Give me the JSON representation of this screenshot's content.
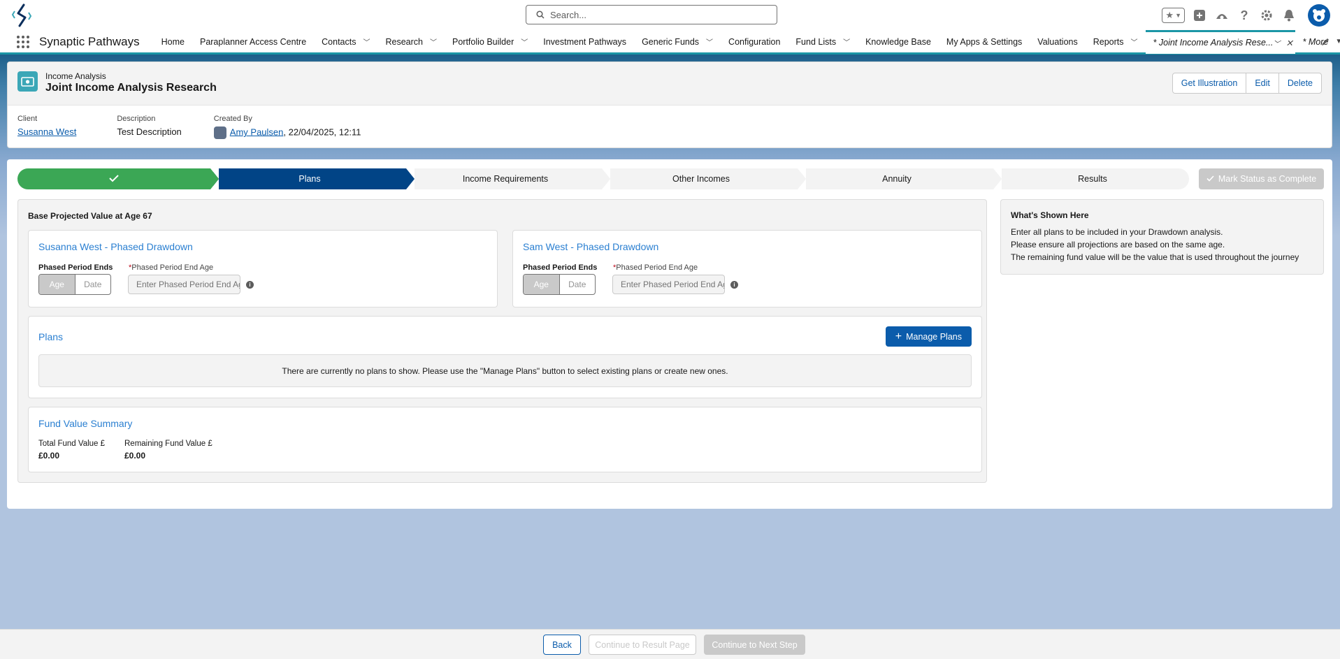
{
  "header": {
    "search_placeholder": "Search..."
  },
  "nav": {
    "app_name": "Synaptic Pathways",
    "items": [
      {
        "label": "Home",
        "dropdown": false
      },
      {
        "label": "Paraplanner Access Centre",
        "dropdown": false
      },
      {
        "label": "Contacts",
        "dropdown": true
      },
      {
        "label": "Research",
        "dropdown": true
      },
      {
        "label": "Portfolio Builder",
        "dropdown": true
      },
      {
        "label": "Investment Pathways",
        "dropdown": false
      },
      {
        "label": "Generic Funds",
        "dropdown": true
      },
      {
        "label": "Configuration",
        "dropdown": false
      },
      {
        "label": "Fund Lists",
        "dropdown": true
      },
      {
        "label": "Knowledge Base",
        "dropdown": false
      },
      {
        "label": "My Apps & Settings",
        "dropdown": false
      },
      {
        "label": "Valuations",
        "dropdown": false
      },
      {
        "label": "Reports",
        "dropdown": true
      }
    ],
    "active_tab": "* Joint Income Analysis Rese...",
    "more": "* More"
  },
  "record": {
    "type": "Income Analysis",
    "title": "Joint Income Analysis Research",
    "buttons": [
      "Get Illustration",
      "Edit",
      "Delete"
    ],
    "client_label": "Client",
    "client_value": "Susanna West",
    "description_label": "Description",
    "description_value": "Test Description",
    "created_by_label": "Created By",
    "created_by_name": "Amy Paulsen",
    "created_by_date": ", 22/04/2025, 12:11"
  },
  "path": {
    "steps": [
      "",
      "Plans",
      "Income Requirements",
      "Other Incomes",
      "Annuity",
      "Results"
    ],
    "complete_index": 0,
    "current_index": 1,
    "mark_complete_label": "Mark Status as Complete"
  },
  "plans_section": {
    "base_title": "Base Projected Value at Age 67",
    "person1": {
      "heading": "Susanna West - Phased Drawdown",
      "ends_label": "Phased Period Ends",
      "toggle_on": "Age",
      "toggle_off": "Date",
      "age_label": "Phased Period End Age",
      "age_placeholder": "Enter Phased Period End Age"
    },
    "person2": {
      "heading": "Sam West - Phased Drawdown",
      "ends_label": "Phased Period Ends",
      "toggle_on": "Age",
      "toggle_off": "Date",
      "age_label": "Phased Period End Age",
      "age_placeholder": "Enter Phased Period End Age"
    },
    "plans": {
      "heading": "Plans",
      "manage_label": "Manage Plans",
      "empty_message": "There are currently no plans to show. Please use the \"Manage Plans\" button to select existing plans or create new ones."
    },
    "summary": {
      "heading": "Fund Value Summary",
      "total_label": "Total Fund Value £",
      "total_value": "£0.00",
      "remaining_label": "Remaining Fund Value £",
      "remaining_value": "£0.00"
    }
  },
  "help": {
    "title": "What's Shown Here",
    "lines": [
      "Enter all plans to be included in your Drawdown analysis.",
      "Please ensure all projections are based on the same age.",
      "The remaining fund value will be the value that is used throughout the journey"
    ]
  },
  "footer": {
    "back": "Back",
    "continue_result": "Continue to Result Page",
    "continue_next": "Continue to Next Step"
  },
  "colors": {
    "brand": "#0b5cab",
    "path_complete": "#3ba755",
    "path_current": "#014486",
    "accent_teal": "#1b96a6",
    "link_heading": "#2a7fd1"
  }
}
